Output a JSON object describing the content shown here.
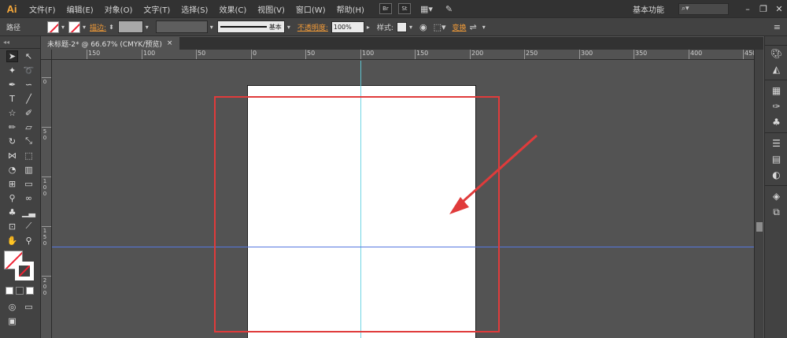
{
  "app": {
    "logo": "Ai",
    "menu": [
      "文件(F)",
      "编辑(E)",
      "对象(O)",
      "文字(T)",
      "选择(S)",
      "效果(C)",
      "视图(V)",
      "窗口(W)",
      "帮助(H)"
    ],
    "menu_icons": {
      "br": "Br",
      "st": "St"
    },
    "workspace_label": "基本功能",
    "search_icon": "search-icon",
    "window_controls": [
      "minimize-icon",
      "restore-icon",
      "close-icon"
    ]
  },
  "control_bar": {
    "selection_label": "路径",
    "stroke_label": "描边:",
    "stroke_style_label": "基本",
    "opacity_label": "不透明度:",
    "opacity_value": "100%",
    "style_label": "样式:",
    "transform_label": "变换"
  },
  "document": {
    "tab_title": "未标题-2* @ 66.67% (CMYK/预览)",
    "close_glyph": "×"
  },
  "ruler_h": {
    "labels": [
      "150",
      "100",
      "50",
      "0",
      "50",
      "100",
      "150",
      "200",
      "250",
      "300",
      "350",
      "400",
      "450"
    ]
  },
  "ruler_v": {
    "labels": [
      "0",
      "5 0",
      "1 0 0",
      "1 5 0",
      "2 0 0"
    ]
  },
  "tools": [
    [
      "selection-tool",
      "direct-selection-tool"
    ],
    [
      "magic-wand-tool",
      "lasso-tool"
    ],
    [
      "pen-tool",
      "curvature-tool"
    ],
    [
      "type-tool",
      "line-tool"
    ],
    [
      "star-tool",
      "paintbrush-tool"
    ],
    [
      "pencil-tool",
      "eraser-tool"
    ],
    [
      "rotate-tool",
      "scale-tool"
    ],
    [
      "width-tool",
      "free-transform-tool"
    ],
    [
      "shape-builder-tool",
      "perspective-grid-tool"
    ],
    [
      "mesh-tool",
      "gradient-tool"
    ],
    [
      "eyedropper-tool",
      "blend-tool"
    ],
    [
      "symbol-sprayer-tool",
      "column-graph-tool"
    ],
    [
      "artboard-tool",
      "slice-tool"
    ],
    [
      "hand-tool",
      "zoom-tool"
    ]
  ],
  "dock_icons": [
    "color-icon",
    "color-guide-icon",
    "swatches-icon",
    "brushes-icon",
    "symbols-icon",
    "stroke-icon",
    "gradient-icon",
    "transparency-icon",
    "layers-icon",
    "artboards-icon"
  ],
  "colors": {
    "annotation_red": "#e03b3b",
    "guide_cyan": "#5fd0e0",
    "guide_blue": "#5578e0",
    "accent_orange": "#f29b38"
  }
}
